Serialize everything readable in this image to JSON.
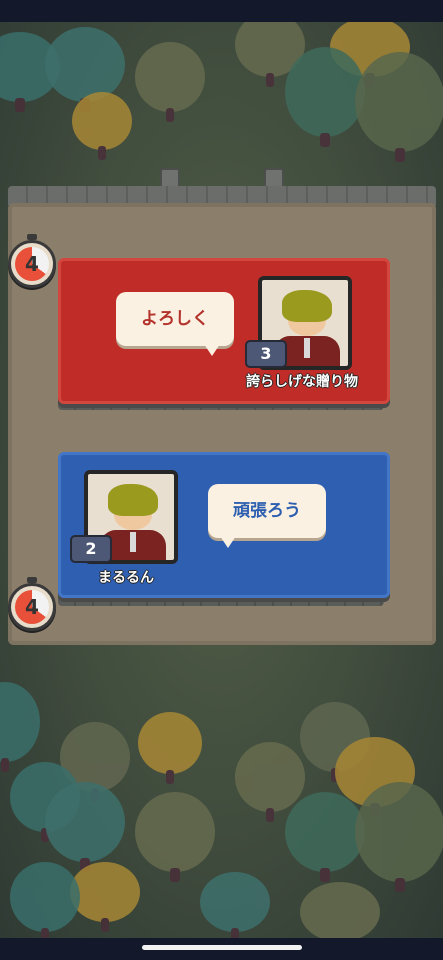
{
  "opponent": {
    "name": "誇らしげな贈り物",
    "level": "3",
    "chat": "よろしく",
    "timer": "4"
  },
  "player": {
    "name": "まるるん",
    "level": "2",
    "chat": "頑張ろう",
    "timer": "4"
  },
  "colors": {
    "opponent_panel": "#c02d28",
    "player_panel": "#2e5fb1",
    "bubble": "#fbf1e2"
  }
}
